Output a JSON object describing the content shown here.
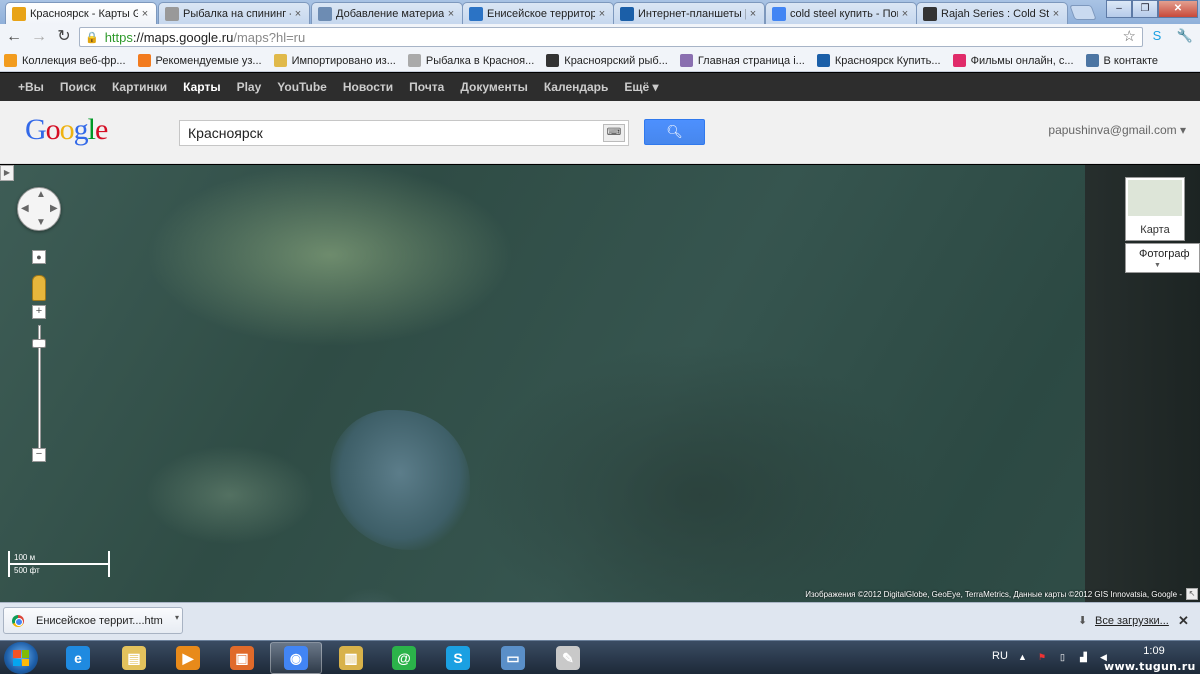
{
  "browser": {
    "tabs": [
      {
        "title": "Красноярск - Карты Google",
        "icon": "google-maps-icon",
        "icon_color": "#e8a317",
        "active": true
      },
      {
        "title": "Рыбалка на спининг - ",
        "icon": "fishing-icon",
        "icon_color": "#999999",
        "active": false
      },
      {
        "title": "Добавление материал",
        "icon": "page-icon",
        "icon_color": "#6d8cb3",
        "active": false
      },
      {
        "title": "Енисейское территори",
        "icon": "circle-x-icon",
        "icon_color": "#2b73c5",
        "active": false
      },
      {
        "title": "Интернет-планшеты | ",
        "icon": "dns-icon",
        "icon_color": "#1b5fa8",
        "active": false
      },
      {
        "title": "cold steel купить - Пои",
        "icon": "google-icon",
        "icon_color": "#4285f4",
        "active": false
      },
      {
        "title": "Rajah Series : Cold Stee",
        "icon": "s-logo-icon",
        "icon_color": "#333333",
        "active": false
      }
    ],
    "window_buttons": [
      "–",
      "❐",
      "✕"
    ],
    "url": {
      "scheme": "https",
      "host": "://maps.google.ru",
      "path": "/maps?hl=ru"
    },
    "bookmarks": [
      {
        "label": "Коллекция веб-фр...",
        "icon": "ok-icon",
        "icon_color": "#f29c1f"
      },
      {
        "label": "Рекомендуемые уз...",
        "icon": "bulb-icon",
        "icon_color": "#f27b1f"
      },
      {
        "label": "Импортировано из...",
        "icon": "folder-icon",
        "icon_color": "#e0b94a"
      },
      {
        "label": "Рыбалка в Красноя...",
        "icon": "fishing-icon",
        "icon_color": "#aaaaaa"
      },
      {
        "label": "Красноярский рыб...",
        "icon": "fish-icon",
        "icon_color": "#333333"
      },
      {
        "label": "Главная страница i...",
        "icon": "diamond-icon",
        "icon_color": "#8a6fb0"
      },
      {
        "label": "Красноярск Купить...",
        "icon": "dns-icon",
        "icon_color": "#1b5fa8"
      },
      {
        "label": "Фильмы онлайн, с...",
        "icon": "ivi-icon",
        "icon_color": "#e02b6a"
      },
      {
        "label": "В контакте",
        "icon": "vk-icon",
        "icon_color": "#4c75a3"
      }
    ]
  },
  "gbar": {
    "items": [
      "+Вы",
      "Поиск",
      "Картинки",
      "Карты",
      "Play",
      "YouTube",
      "Новости",
      "Почта",
      "Документы",
      "Календарь",
      "Ещё ▾"
    ],
    "active": "Карты"
  },
  "header": {
    "logo_letters": [
      {
        "ch": "G",
        "color": "#3369e8"
      },
      {
        "ch": "o",
        "color": "#d50f25"
      },
      {
        "ch": "o",
        "color": "#eeb211"
      },
      {
        "ch": "g",
        "color": "#3369e8"
      },
      {
        "ch": "l",
        "color": "#009925"
      },
      {
        "ch": "e",
        "color": "#d50f25"
      }
    ],
    "search_value": "Красноярск",
    "account": "papushinva@gmail.com ▾"
  },
  "map": {
    "scale_metric": "100 м",
    "scale_imperial": "500 фт",
    "map_type_label": "Карта",
    "satellite_label": "Фотограф",
    "copyright": "Изображения ©2012 DigitalGlobe, GeoEye, TerraMetrics, Данные карты ©2012 GIS Innovatsia, Google -"
  },
  "downloads": {
    "file": "Енисейское террит....htm",
    "all_label": "Все загрузки..."
  },
  "taskbar": {
    "apps": [
      {
        "name": "ie-icon",
        "color": "#1f8ae0",
        "glyph": "e"
      },
      {
        "name": "explorer-icon",
        "color": "#e3c25d",
        "glyph": "▤"
      },
      {
        "name": "media-player-icon",
        "color": "#e88a1a",
        "glyph": "▶"
      },
      {
        "name": "installer-icon",
        "color": "#e06a2a",
        "glyph": "▣"
      },
      {
        "name": "chrome-icon",
        "color": "#4285f4",
        "glyph": "◉"
      },
      {
        "name": "folder-icon",
        "color": "#d8b24a",
        "glyph": "▥"
      },
      {
        "name": "mail-agent-icon",
        "color": "#2bb34a",
        "glyph": "@"
      },
      {
        "name": "skype-icon",
        "color": "#1ba0e2",
        "glyph": "S"
      },
      {
        "name": "window-icon",
        "color": "#5a8fc8",
        "glyph": "▭"
      },
      {
        "name": "paint-icon",
        "color": "#c9c9c9",
        "glyph": "✎"
      }
    ],
    "lang": "RU",
    "time": "1:09",
    "watermark": "www.tugun.ru"
  }
}
